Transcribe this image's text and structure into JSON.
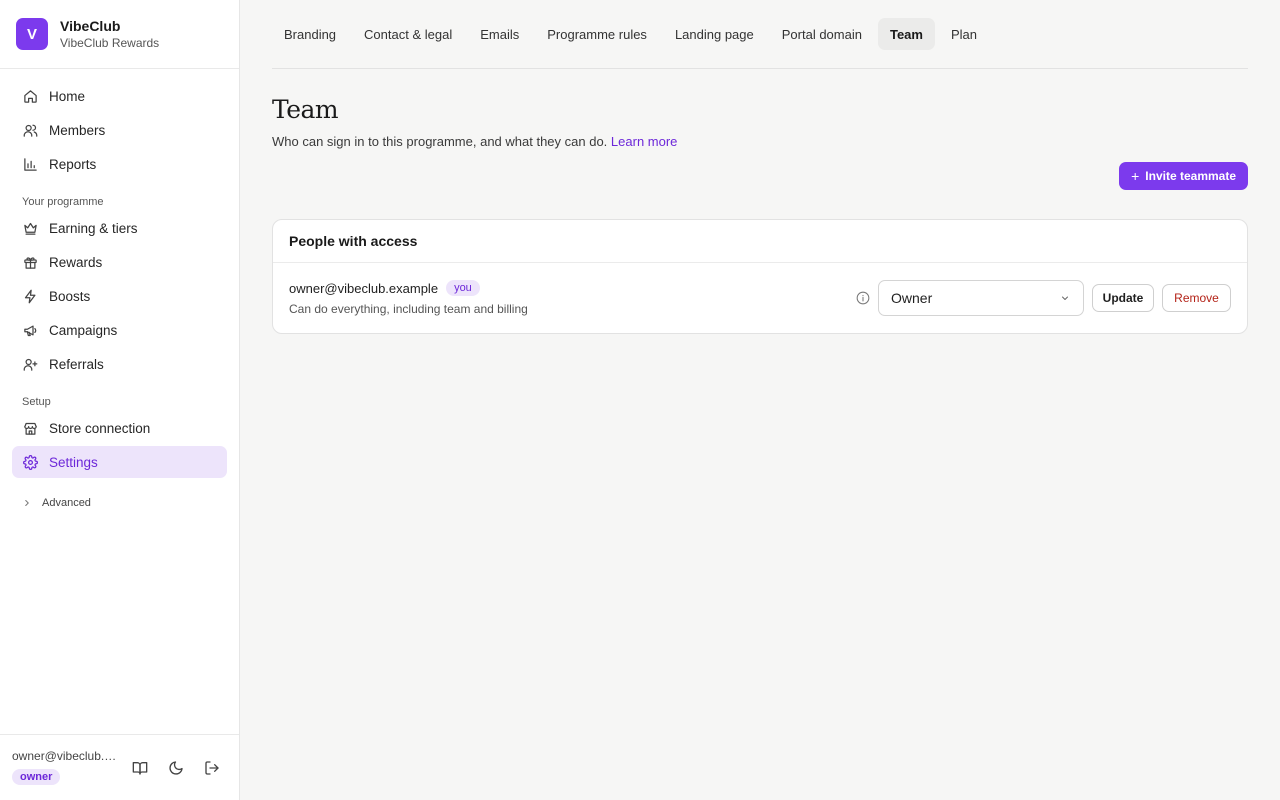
{
  "brand": {
    "logo_letter": "V",
    "name": "VibeClub",
    "subtitle": "VibeClub Rewards"
  },
  "nav": {
    "items": [
      {
        "label": "Home",
        "icon": "home-icon"
      },
      {
        "label": "Members",
        "icon": "users-icon"
      },
      {
        "label": "Reports",
        "icon": "bar-chart-icon"
      }
    ],
    "section_programme": "Your programme",
    "programme_items": [
      {
        "label": "Earning & tiers",
        "icon": "crown-icon"
      },
      {
        "label": "Rewards",
        "icon": "gift-icon"
      },
      {
        "label": "Boosts",
        "icon": "lightning-icon"
      },
      {
        "label": "Campaigns",
        "icon": "megaphone-icon"
      },
      {
        "label": "Referrals",
        "icon": "user-plus-icon"
      }
    ],
    "section_setup": "Setup",
    "setup_items": [
      {
        "label": "Store connection",
        "icon": "store-icon"
      },
      {
        "label": "Settings",
        "icon": "gear-icon",
        "active": true
      }
    ],
    "advanced_label": "Advanced"
  },
  "footer": {
    "email": "owner@vibeclub.example",
    "role_badge": "owner"
  },
  "tabs": [
    {
      "label": "Branding"
    },
    {
      "label": "Contact & legal"
    },
    {
      "label": "Emails"
    },
    {
      "label": "Programme rules"
    },
    {
      "label": "Landing page"
    },
    {
      "label": "Portal domain"
    },
    {
      "label": "Team",
      "active": true
    },
    {
      "label": "Plan"
    }
  ],
  "page": {
    "title": "Team",
    "description": "Who can sign in to this programme, and what they can do.",
    "learn_more": "Learn more",
    "invite_button": "Invite teammate"
  },
  "access_card": {
    "title": "People with access",
    "people": [
      {
        "email": "owner@vibeclub.example",
        "badge": "you",
        "description": "Can do everything, including team and billing",
        "role": "Owner",
        "update_label": "Update",
        "remove_label": "Remove"
      }
    ]
  },
  "colors": {
    "accent": "#7c3aed",
    "accent_light": "#ede4fb",
    "danger": "#b42318"
  }
}
